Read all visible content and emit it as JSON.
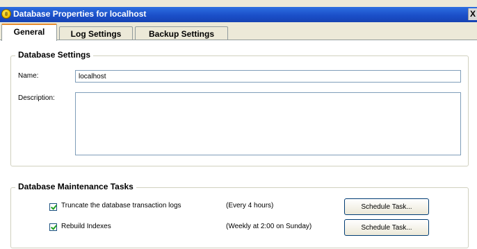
{
  "window": {
    "title": "Database Properties for localhost",
    "close_label": "X"
  },
  "tabs": [
    {
      "label": "General",
      "active": true
    },
    {
      "label": "Log Settings",
      "active": false
    },
    {
      "label": "Backup Settings",
      "active": false
    }
  ],
  "database_settings": {
    "title": "Database Settings",
    "name_label": "Name:",
    "name_value": "localhost",
    "description_label": "Description:",
    "description_value": ""
  },
  "maintenance": {
    "title": "Database Maintenance Tasks",
    "tasks": [
      {
        "label": "Truncate the database transaction logs",
        "checked": true,
        "schedule": "(Every 4 hours)",
        "button": "Schedule Task..."
      },
      {
        "label": "Rebuild Indexes",
        "checked": true,
        "schedule": "(Weekly at 2:00  on Sunday)",
        "button": "Schedule Task..."
      }
    ]
  },
  "colors": {
    "titlebar": "#1b4fc9",
    "tab_active_highlight": "#e68b2c",
    "checkbox_check": "#21a121"
  }
}
